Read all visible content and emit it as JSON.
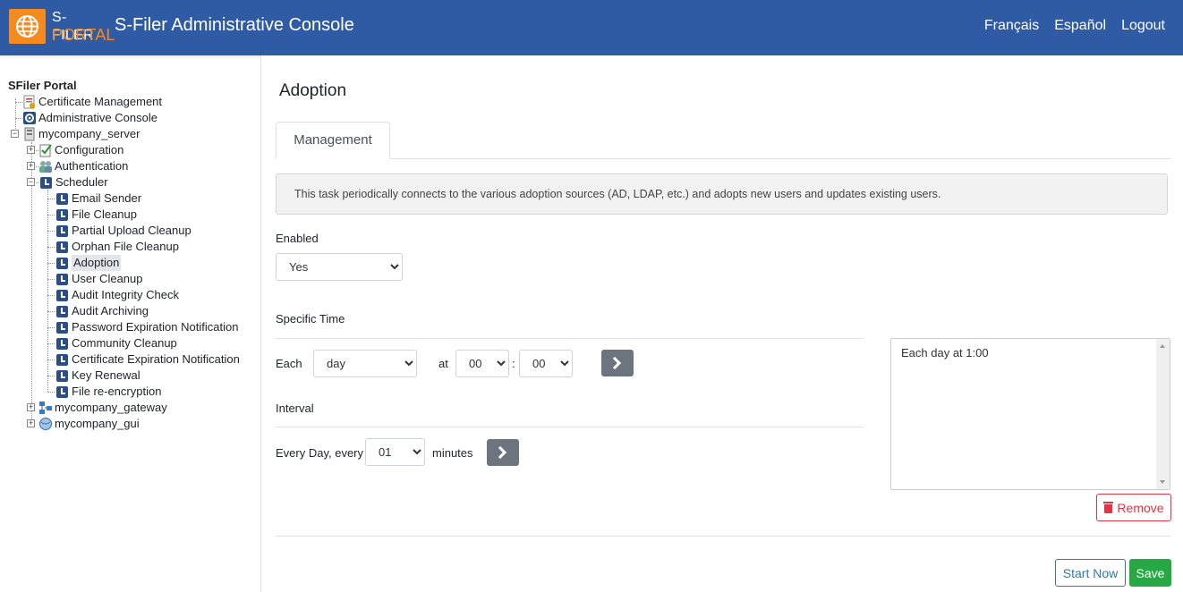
{
  "header": {
    "logo_line1": "S-FILER",
    "logo_line2": "PORTAL",
    "title": "S-Filer Administrative Console",
    "links": [
      "Français",
      "Español",
      "Logout"
    ],
    "bg_color": "#2f5aa4",
    "accent_color": "#f58a1f"
  },
  "tree": {
    "root": "SFiler Portal",
    "top_items": [
      "Certificate Management",
      "Administrative Console",
      "mycompany_server"
    ],
    "server_children": [
      "Configuration",
      "Authentication",
      "Scheduler"
    ],
    "scheduler_tasks": [
      "Email Sender",
      "File Cleanup",
      "Partial Upload Cleanup",
      "Orphan File Cleanup",
      "Adoption",
      "User Cleanup",
      "Audit Integrity Check",
      "Audit Archiving",
      "Password Expiration Notification",
      "Community Cleanup",
      "Certificate Expiration Notification",
      "Key Renewal",
      "File re-encryption"
    ],
    "selected": "Adoption",
    "bottom_items": [
      "mycompany_gateway",
      "mycompany_gui"
    ]
  },
  "main": {
    "title": "Adoption",
    "tab_label": "Management",
    "description": "This task periodically connects to the various adoption sources (AD, LDAP, etc.) and adopts new users and updates existing users.",
    "enabled_label": "Enabled",
    "enabled_value": "Yes",
    "specific_time_label": "Specific Time",
    "each_label": "Each",
    "each_value": "day",
    "at_label": "at",
    "hour_value": "00",
    "colon": ":",
    "minute_value": "00",
    "interval_label": "Interval",
    "every_label": "Every Day, every",
    "interval_value": "01",
    "minutes_label": "minutes",
    "schedule_entries": [
      "Each day at 1:00"
    ],
    "remove_label": "Remove",
    "start_now_label": "Start Now",
    "save_label": "Save"
  }
}
